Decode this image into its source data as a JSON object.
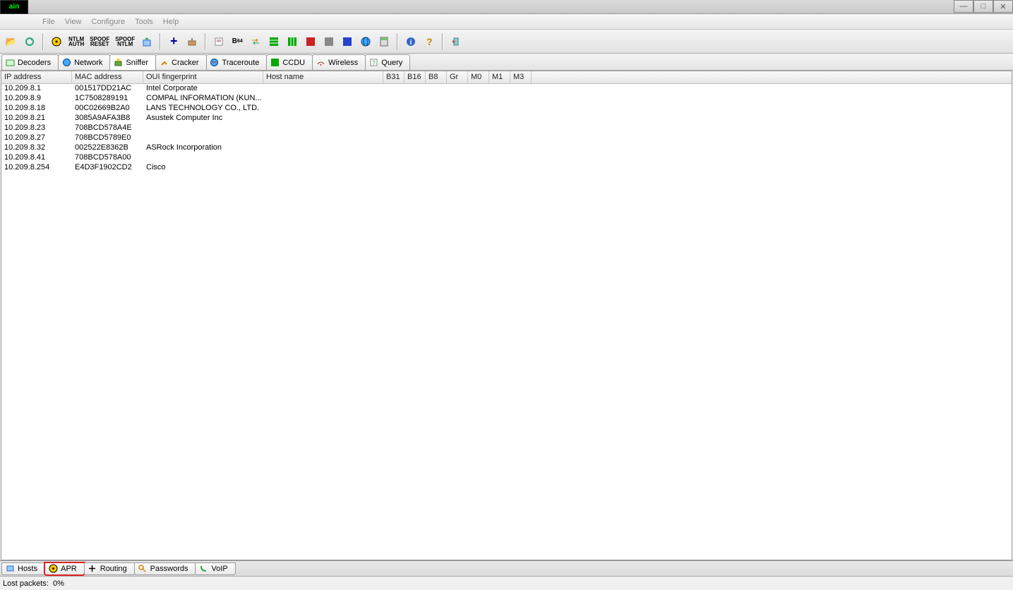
{
  "titlebar": {
    "logo_text": "ain"
  },
  "window_controls": {
    "min": "—",
    "max": "□",
    "close": "✕"
  },
  "menu": {
    "file": "File",
    "view": "View",
    "configure": "Configure",
    "tools": "Tools",
    "help": "Help"
  },
  "toolbar": {
    "open": "📂",
    "refresh": "🔄",
    "nuke": "☢",
    "ntlm_auth": "NTLM\nAUTH",
    "spoof_reset": "SPOOF\nRESET",
    "spoof_ntlm": "SPOOF\nNTLM",
    "export": "📤",
    "add": "+",
    "crack": "🔨",
    "dict": "📋",
    "b64": "B₆₄",
    "arrows": "↔",
    "green1": "▦",
    "green2": "▦",
    "red": "▦",
    "gray": "▦",
    "blue": "▦",
    "globe": "🌐",
    "calc": "🧮",
    "info": "ℹ",
    "help": "?",
    "exit": "⎋"
  },
  "upper_tabs": {
    "decoders": "Decoders",
    "network": "Network",
    "sniffer": "Sniffer",
    "cracker": "Cracker",
    "traceroute": "Traceroute",
    "ccdu": "CCDU",
    "wireless": "Wireless",
    "query": "Query"
  },
  "columns": {
    "ip": "IP address",
    "mac": "MAC address",
    "oui": "OUI fingerprint",
    "host": "Host name",
    "b31": "B31",
    "b16": "B16",
    "b8": "B8",
    "gr": "Gr",
    "m0": "M0",
    "m1": "M1",
    "m3": "M3"
  },
  "rows": [
    {
      "ip": "10.209.8.1",
      "mac": "001517DD21AC",
      "oui": "Intel Corporate",
      "host": ""
    },
    {
      "ip": "10.209.8.9",
      "mac": "1C7508289191",
      "oui": "COMPAL INFORMATION (KUN...",
      "host": ""
    },
    {
      "ip": "10.209.8.18",
      "mac": "00C02669B2A0",
      "oui": "LANS TECHNOLOGY CO., LTD.",
      "host": ""
    },
    {
      "ip": "10.209.8.21",
      "mac": "3085A9AFA3B8",
      "oui": "Asustek Computer Inc",
      "host": ""
    },
    {
      "ip": "10.209.8.23",
      "mac": "708BCD578A4E",
      "oui": "",
      "host": ""
    },
    {
      "ip": "10.209.8.27",
      "mac": "708BCD5789E0",
      "oui": "",
      "host": ""
    },
    {
      "ip": "10.209.8.32",
      "mac": "002522E8362B",
      "oui": "ASRock Incorporation",
      "host": ""
    },
    {
      "ip": "10.209.8.41",
      "mac": "708BCD578A00",
      "oui": "",
      "host": ""
    },
    {
      "ip": "10.209.8.254",
      "mac": "E4D3F1902CD2",
      "oui": "Cisco",
      "host": ""
    }
  ],
  "lower_tabs": {
    "hosts": "Hosts",
    "apr": "APR",
    "routing": "Routing",
    "passwords": "Passwords",
    "voip": "VoIP"
  },
  "status": {
    "lost_packets_label": "Lost packets:",
    "lost_packets_value": "0%"
  }
}
